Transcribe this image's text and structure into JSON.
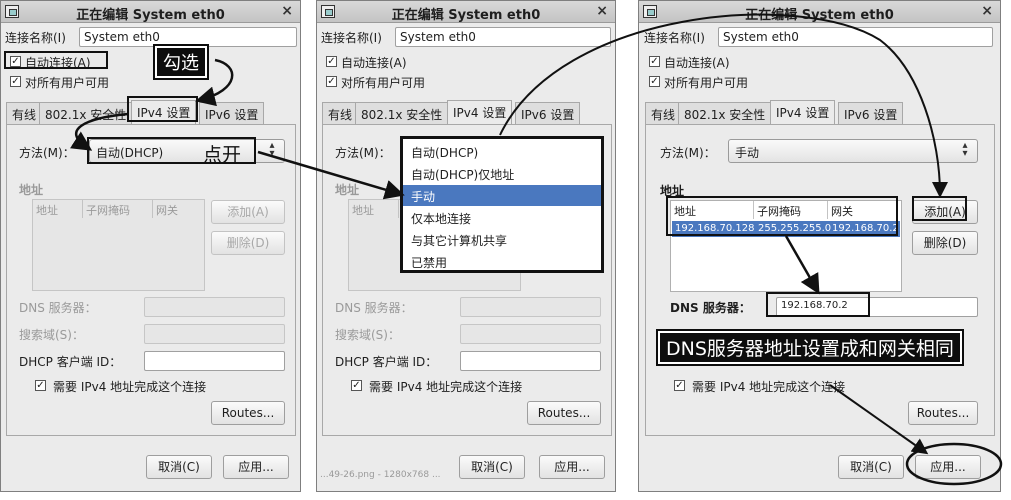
{
  "window": {
    "title": "正在编辑 System eth0",
    "close_glyph": "×"
  },
  "form": {
    "conn_name_label": "连接名称(I)",
    "conn_name_value": "System eth0",
    "auto_connect_label": "自动连接(A)",
    "all_users_label": "对所有用户可用",
    "check_glyph": "✓"
  },
  "tabs": [
    "有线",
    "802.1x 安全性",
    "IPv4 设置",
    "IPv6 设置"
  ],
  "ipv4": {
    "method_label": "方法(M)：",
    "method_value_1": "自动(DHCP)",
    "method_value_3": "手动",
    "address_section": "地址",
    "col_address": "地址",
    "col_netmask": "子网掩码",
    "col_gateway": "网关",
    "add_button": "添加(A)",
    "delete_button": "删除(D)",
    "dns_label": "DNS 服务器：",
    "dns_value": "192.168.70.2",
    "search_label": "搜索域(S)：",
    "dhcp_id_label": "DHCP 客户端 ID：",
    "require_ipv4_label": "需要 IPv4 地址完成这个连接",
    "routes_button": "Routes..."
  },
  "address_row": {
    "address": "192.168.70.128",
    "netmask": "255.255.255.0",
    "gateway": "192.168.70.2"
  },
  "dropdown_options": [
    "自动(DHCP)",
    "自动(DHCP)仅地址",
    "手动",
    "仅本地连接",
    "与其它计算机共享",
    "已禁用"
  ],
  "dropdown_selected_index": 2,
  "dialog_buttons": {
    "cancel": "取消(C)",
    "apply": "应用..."
  },
  "annotations": {
    "check_callout": "勾选",
    "open_callout": "点开",
    "dns_callout": "DNS服务器地址设置成和网关相同"
  },
  "footer_caption": "...49-26.png - 1280x768 ..."
}
